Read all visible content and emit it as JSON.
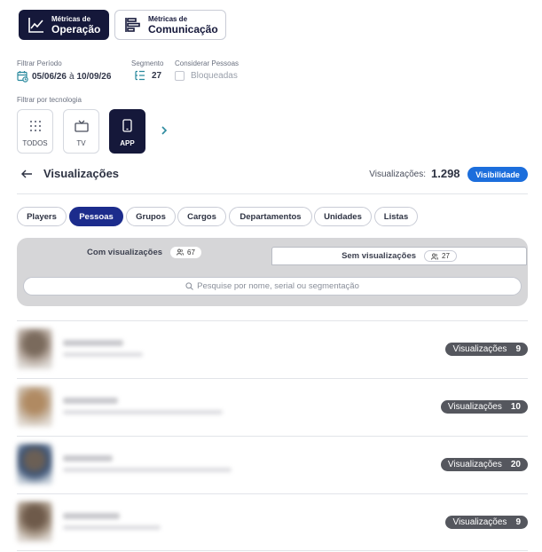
{
  "metrics_toggle": {
    "operacao": {
      "small": "Métricas de",
      "big": "Operação"
    },
    "comunicacao": {
      "small": "Métricas de",
      "big": "Comunicação"
    }
  },
  "filters": {
    "period_label": "Filtrar Período",
    "period_start": "05/06/26",
    "period_separator": "à",
    "period_end": "10/09/26",
    "segment_label": "Segmento",
    "segment_count": "27",
    "people_label": "Considerar Pessoas",
    "blocked_label": "Bloqueadas",
    "blocked_checked": false,
    "tech_label": "Filtrar por tecnologia",
    "tech": [
      {
        "label": "TODOS",
        "icon": "grid-dots-icon"
      },
      {
        "label": "TV",
        "icon": "tv-icon"
      },
      {
        "label": "APP",
        "icon": "smartphone-icon",
        "active": true
      }
    ]
  },
  "header": {
    "title": "Visualizações",
    "views_label": "Visualizações:",
    "views_count": "1.298",
    "badge": "Visibilidade",
    "badge_color": "#1c6edc"
  },
  "tabs": [
    {
      "label": "Players"
    },
    {
      "label": "Pessoas",
      "active": true
    },
    {
      "label": "Grupos"
    },
    {
      "label": "Cargos"
    },
    {
      "label": "Departamentos"
    },
    {
      "label": "Unidades"
    },
    {
      "label": "Listas"
    }
  ],
  "view_tabs": {
    "with": {
      "label": "Com visualizações",
      "count": "67"
    },
    "without": {
      "label": "Sem visualizações",
      "count": "27"
    }
  },
  "search": {
    "placeholder": "Pesquise por nome, serial ou segmentação"
  },
  "people": [
    {
      "views_label": "Visualizações",
      "views": "9"
    },
    {
      "views_label": "Visualizações",
      "views": "10"
    },
    {
      "views_label": "Visualizações",
      "views": "20"
    },
    {
      "views_label": "Visualizações",
      "views": "9"
    }
  ]
}
